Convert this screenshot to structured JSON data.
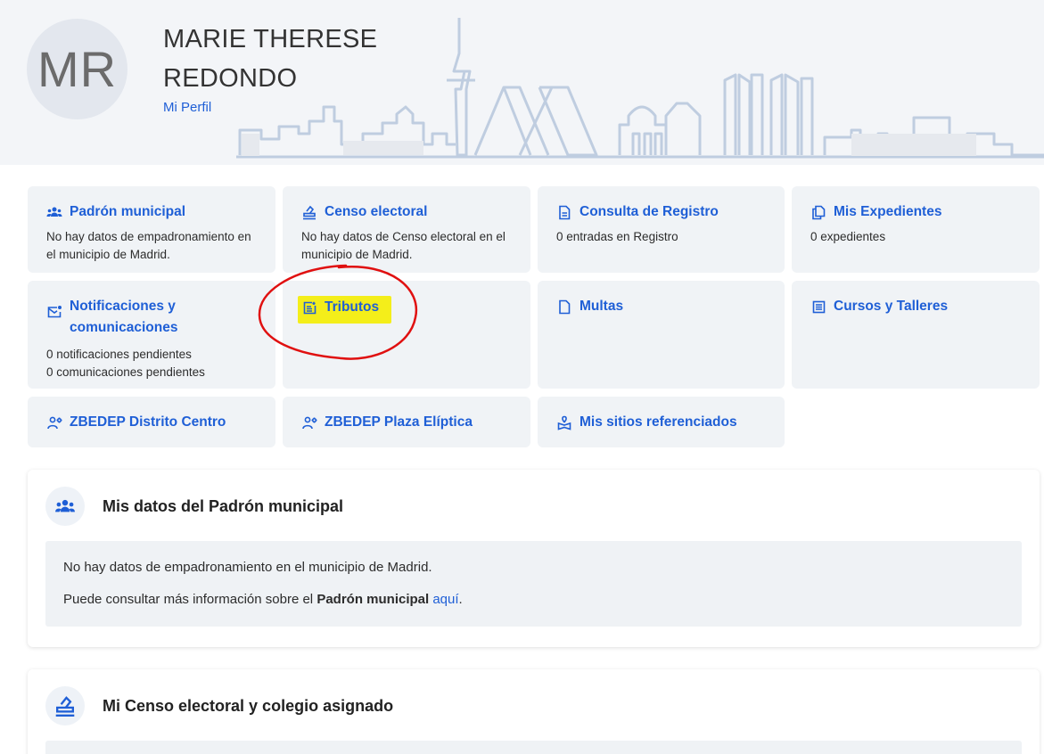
{
  "user": {
    "initials": "MR",
    "name": "MARIE THERESE REDONDO",
    "profile_link": "Mi Perfil"
  },
  "colors": {
    "link": "#1f5fd6",
    "card_bg": "#f0f3f6",
    "highlight": "#f4ee1a",
    "annotation": "#e01010"
  },
  "cards": [
    {
      "title": "Padrón municipal",
      "icon": "people-group-icon",
      "desc": [
        "No hay datos de empadronamiento en el municipio de Madrid."
      ]
    },
    {
      "title": "Censo electoral",
      "icon": "ballot-box-icon",
      "desc": [
        "No hay datos de Censo electoral en el municipio de Madrid."
      ]
    },
    {
      "title": "Consulta de Registro",
      "icon": "document-icon",
      "desc": [
        "0 entradas en Registro"
      ]
    },
    {
      "title": "Mis Expedientes",
      "icon": "files-icon",
      "desc": [
        "0 expedientes"
      ]
    },
    {
      "title": "Notificaciones y comunicaciones",
      "icon": "mail-notification-icon",
      "desc": [
        "0 notificaciones pendientes",
        "0 comunicaciones pendientes"
      ]
    },
    {
      "title": "Tributos",
      "icon": "tax-document-icon",
      "desc": []
    },
    {
      "title": "Multas",
      "icon": "document-icon",
      "desc": []
    },
    {
      "title": "Cursos y Talleres",
      "icon": "list-icon",
      "desc": []
    },
    {
      "title": "ZBEDEP Distrito Centro",
      "icon": "person-gear-icon",
      "desc": []
    },
    {
      "title": "ZBEDEP Plaza Elíptica",
      "icon": "person-gear-icon",
      "desc": []
    },
    {
      "title": "Mis sitios referenciados",
      "icon": "location-book-icon",
      "desc": []
    }
  ],
  "padron_panel": {
    "title": "Mis datos del Padrón municipal",
    "icon": "people-group-icon",
    "line1": "No hay datos de empadronamiento en el municipio de Madrid.",
    "line2_prefix": "Puede consultar más información sobre el ",
    "line2_bold": "Padrón municipal",
    "line2_link": "aquí",
    "line2_suffix": "."
  },
  "censo_panel": {
    "title": "Mi Censo electoral y colegio asignado",
    "icon": "ballot-box-icon"
  }
}
